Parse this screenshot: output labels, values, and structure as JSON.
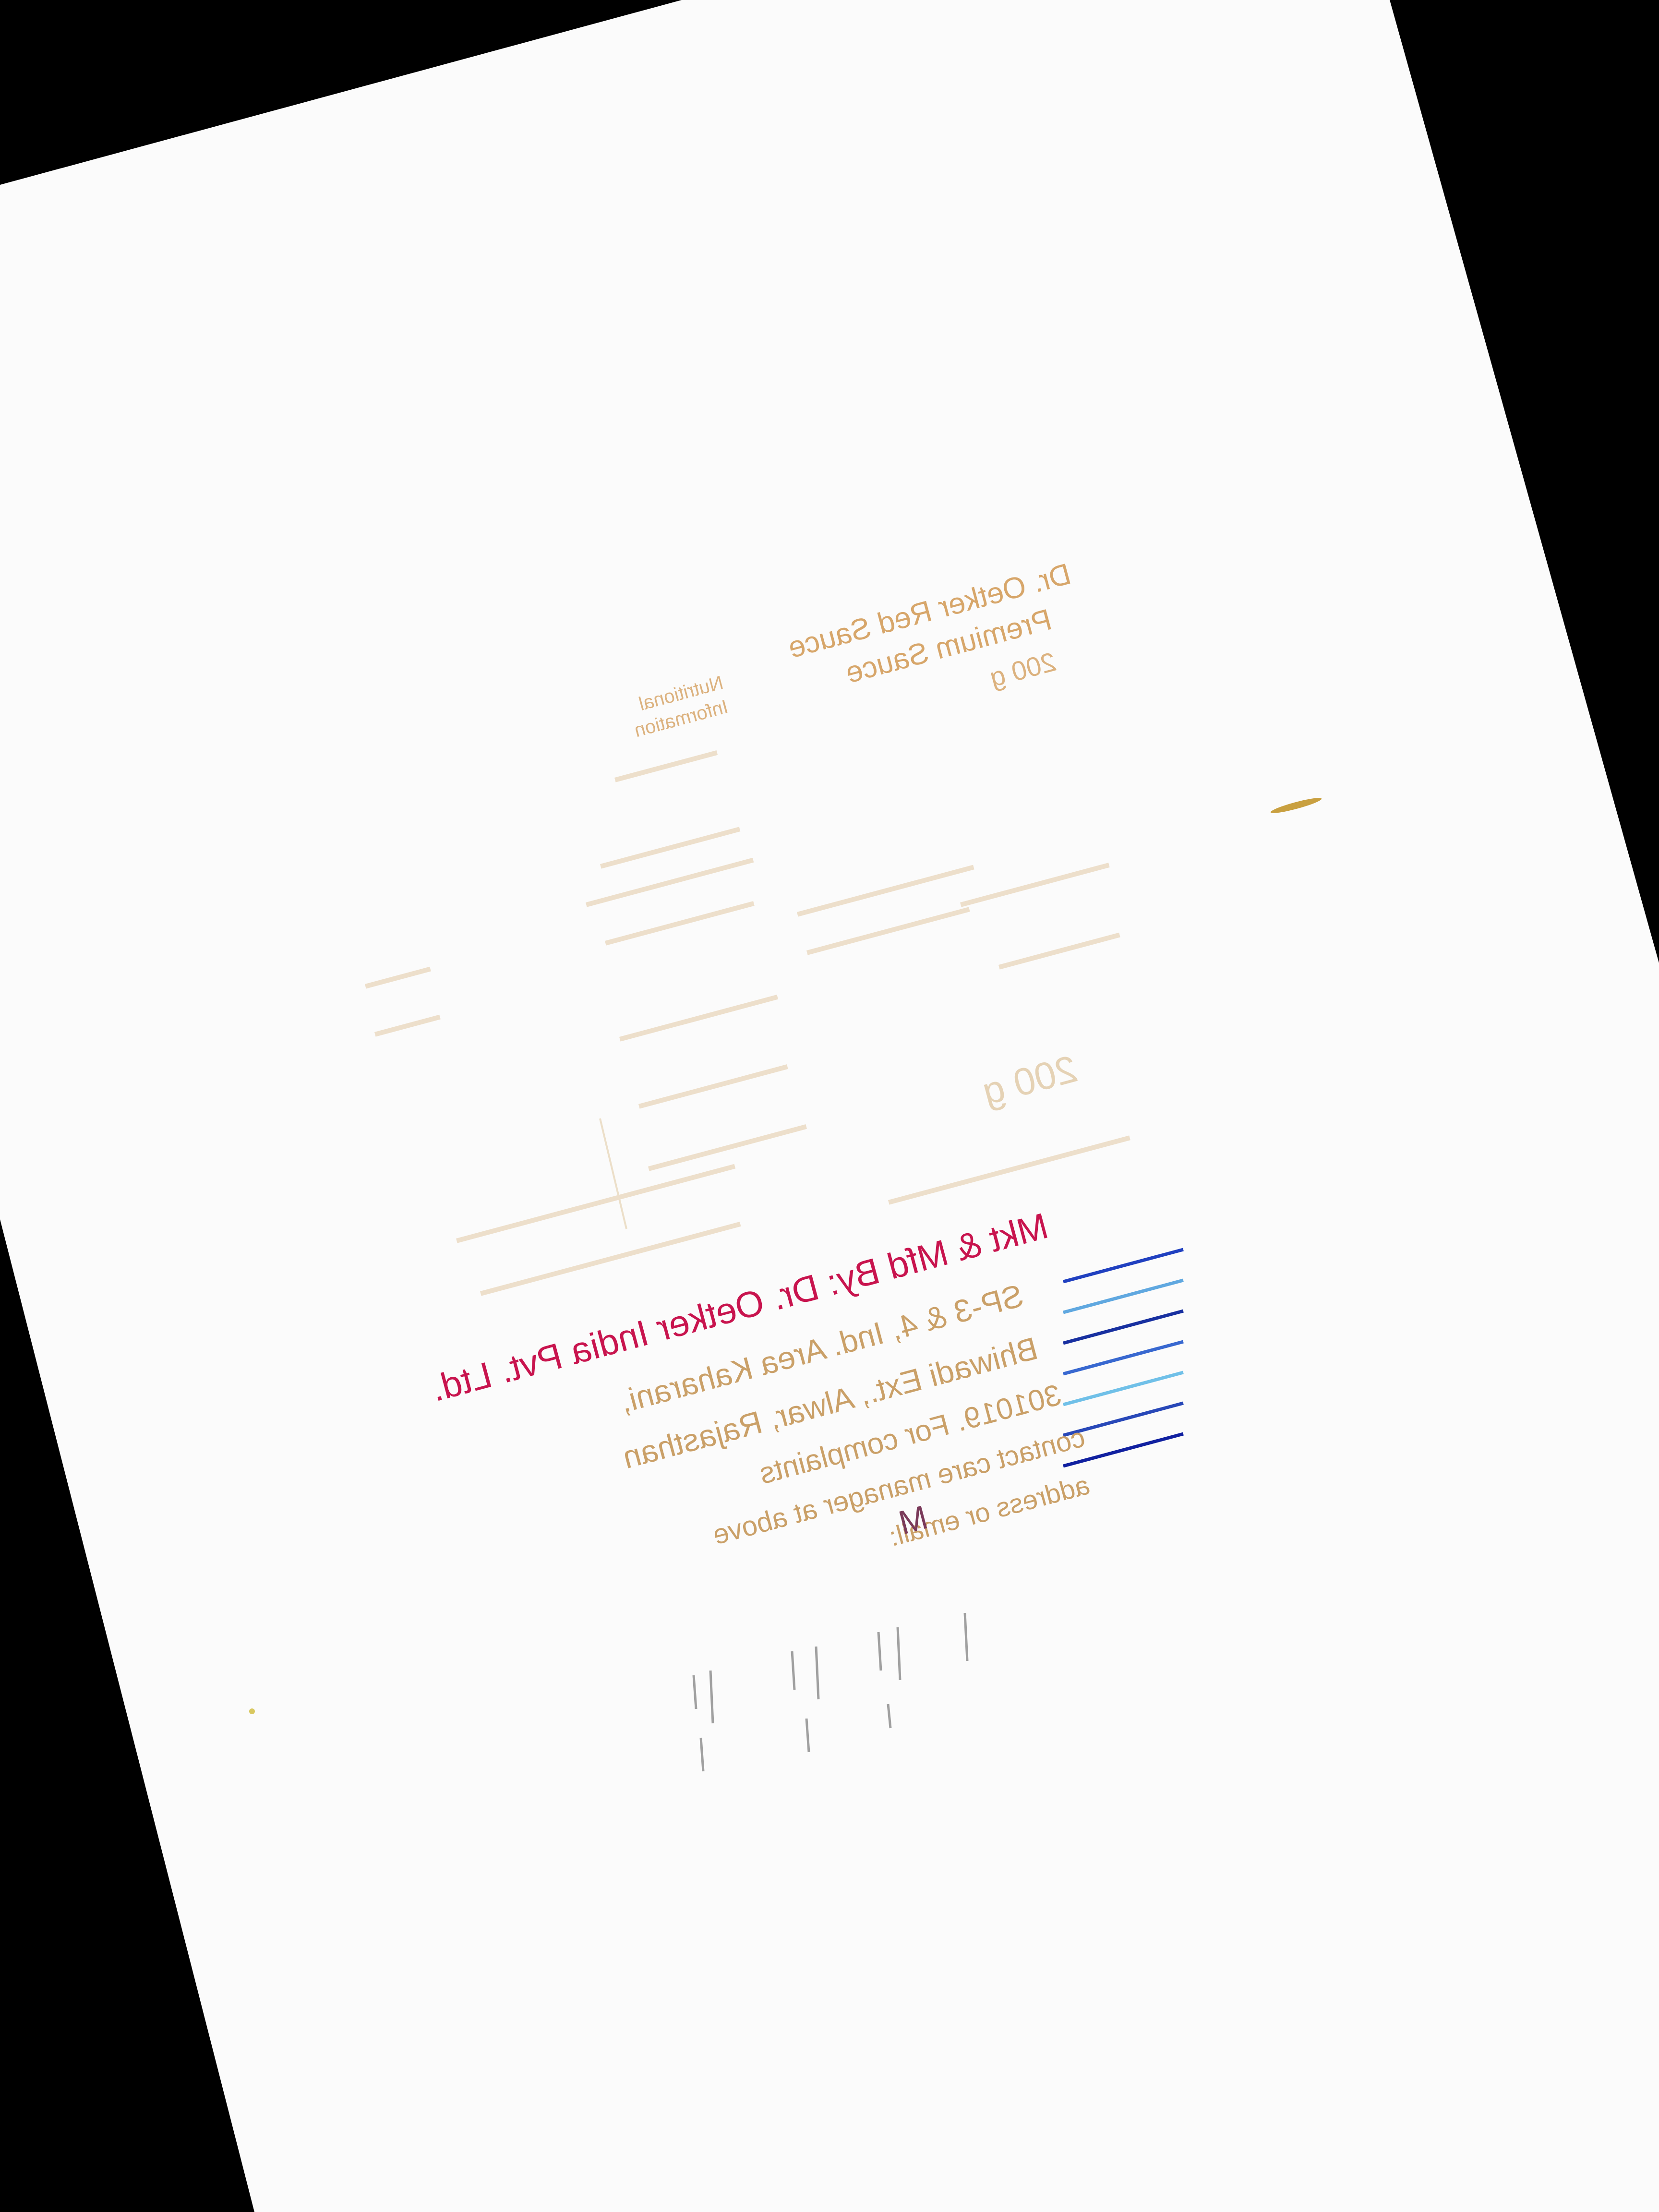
{
  "photo": {
    "subject": "",
    "colors": {
      "background": "#000000",
      "paper": "#fbfbfb",
      "header_text": "#c9832e",
      "company_text": "#c8144e",
      "address_text": "#caa068",
      "faint_text": "#d8b888",
      "batch_text": "#6a6a6a"
    }
  },
  "label": {
    "product_header": [
      "Dr. Oetker Red Sauce",
      "Premium Sauce",
      "200 g"
    ],
    "nutrition_heading": [
      "Nutritional",
      "Information"
    ],
    "weight_value": "200 g",
    "company_line": "Mkt & Mfd By: Dr. Oetker India Pvt. Ltd.",
    "address_lines": [
      "SP-3 & 4, Ind. Area Kaharani,",
      "Bhiwadi Ext., Alwar, Rajasthan",
      "301019. For complaints",
      "contact care manager at above",
      "address or email:",
      "M"
    ],
    "barcode_stripe_colors": [
      "#2040c0",
      "#60a8e0",
      "#1830a0",
      "#3868d0",
      "#70c0e8",
      "#2848b8",
      "#1020a0"
    ],
    "batch_marks": [
      "",
      ""
    ]
  }
}
